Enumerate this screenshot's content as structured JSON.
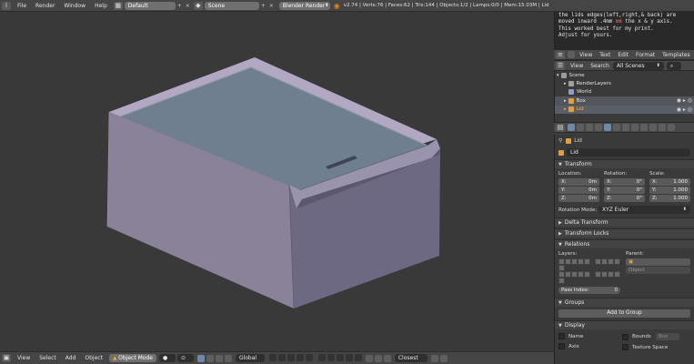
{
  "topbar": {
    "menus": [
      "File",
      "Render",
      "Window",
      "Help"
    ],
    "screen_layout": "Default",
    "scene": "Scene",
    "render_engine": "Blender Render",
    "version_stats": "v2.74 | Verts:76 | Faces:62 | Tris:144 | Objects:1/2 | Lamps:0/0 | Mem:15.03M | Lid"
  },
  "text_editor": {
    "lines": [
      "the lids edges(left,right,& back) are",
      "moved inward .4mm on the x & y axis.",
      "This worked best for my print.",
      "Adjust for yours."
    ],
    "header_menus": [
      "View",
      "Text",
      "Edit",
      "Format",
      "Templates"
    ]
  },
  "outliner": {
    "header": {
      "view": "View",
      "search": "Search",
      "filter": "All Scenes"
    },
    "rows": [
      {
        "label": "Scene",
        "color": "#9c9c9c"
      },
      {
        "label": "RenderLayers",
        "color": "#a0a0a0"
      },
      {
        "label": "World",
        "color": "#8aa0c8"
      },
      {
        "label": "Box",
        "color": "#e0a040"
      },
      {
        "label": "Lid",
        "color": "#e0a040"
      }
    ]
  },
  "properties": {
    "breadcrumb": "Lid",
    "object_name": "Lid",
    "transform": {
      "title": "Transform",
      "location_label": "Location:",
      "rotation_label": "Rotation:",
      "scale_label": "Scale:",
      "location": [
        {
          "axis": "X:",
          "value": "0m"
        },
        {
          "axis": "Y:",
          "value": "0m"
        },
        {
          "axis": "Z:",
          "value": "0m"
        }
      ],
      "rotation": [
        {
          "axis": "X:",
          "value": "0°"
        },
        {
          "axis": "Y:",
          "value": "0°"
        },
        {
          "axis": "Z:",
          "value": "0°"
        }
      ],
      "scale": [
        {
          "axis": "X:",
          "value": "1.000"
        },
        {
          "axis": "Y:",
          "value": "1.000"
        },
        {
          "axis": "Z:",
          "value": "1.000"
        }
      ],
      "rotation_mode_label": "Rotation Mode:",
      "rotation_mode": "XYZ Euler"
    },
    "delta_transform": "Delta Transform",
    "transform_locks": "Transform Locks",
    "relations": {
      "title": "Relations",
      "layers_label": "Layers:",
      "parent_label": "Parent:",
      "parent_type": "Object",
      "pass_index_label": "Pass Index:",
      "pass_index": "0"
    },
    "groups": {
      "title": "Groups",
      "add_button": "Add to Group"
    },
    "display": {
      "title": "Display",
      "name": "Name",
      "axis": "Axis",
      "bounds": "Bounds",
      "bounds_type": "Box",
      "texture_space": "Texture Space"
    }
  },
  "viewport_header": {
    "menus": [
      "View",
      "Select",
      "Add",
      "Object"
    ],
    "mode": "Object Mode",
    "orientation": "Global",
    "snap": "Closest"
  },
  "colors": {
    "box_front": "#6e6982",
    "box_side": "#8a8299",
    "lid_top": "#6f7f90",
    "rim": "#b2a8c4",
    "selection": "#ffaf40"
  }
}
